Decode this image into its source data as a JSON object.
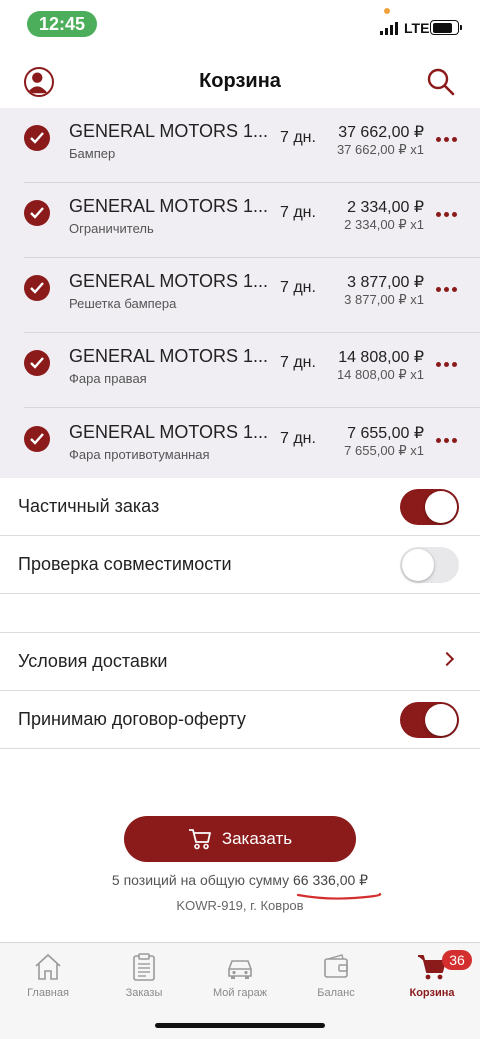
{
  "status_bar": {
    "time": "12:45",
    "network": "LTE"
  },
  "header": {
    "title": "Корзина"
  },
  "cart": {
    "items": [
      {
        "title": "GENERAL MOTORS 1...",
        "subtitle": "Бампер",
        "days": "7 дн.",
        "price": "37 662,00 ₽",
        "unit": "37 662,00 ₽ x1"
      },
      {
        "title": "GENERAL MOTORS 1...",
        "subtitle": "Ограничитель",
        "days": "7 дн.",
        "price": "2 334,00 ₽",
        "unit": "2 334,00 ₽ x1"
      },
      {
        "title": "GENERAL MOTORS 1...",
        "subtitle": "Решетка бампера",
        "days": "7 дн.",
        "price": "3 877,00 ₽",
        "unit": "3 877,00 ₽ x1"
      },
      {
        "title": "GENERAL MOTORS 1...",
        "subtitle": "Фара правая",
        "days": "7 дн.",
        "price": "14 808,00 ₽",
        "unit": "14 808,00 ₽ x1"
      },
      {
        "title": "GENERAL MOTORS 1...",
        "subtitle": "Фара противотуманная",
        "days": "7 дн.",
        "price": "7 655,00 ₽",
        "unit": "7 655,00 ₽ x1"
      }
    ]
  },
  "settings": {
    "partial_order": {
      "label": "Частичный заказ",
      "on": true
    },
    "compatibility": {
      "label": "Проверка совместимости",
      "on": false
    },
    "delivery": {
      "label": "Условия доставки"
    },
    "offer": {
      "label": "Принимаю договор-оферту",
      "on": true
    }
  },
  "order": {
    "button_label": "Заказать",
    "summary_prefix": "5 позиций на общую сумму",
    "summary_total": "66 336,00 ₽",
    "address": "KOWR-919, г. Ковров"
  },
  "tabs": [
    {
      "label": "Главная",
      "icon": "home-icon",
      "active": false
    },
    {
      "label": "Заказы",
      "icon": "clipboard-icon",
      "active": false
    },
    {
      "label": "Мой гараж",
      "icon": "car-icon",
      "active": false
    },
    {
      "label": "Баланс",
      "icon": "wallet-icon",
      "active": false
    },
    {
      "label": "Корзина",
      "icon": "cart-icon",
      "active": true
    }
  ],
  "cart_badge": "36",
  "colors": {
    "accent": "#8b1a1a",
    "status_green": "#4cae5a",
    "badge": "#d32f2f",
    "list_bg": "#f0eef2"
  }
}
